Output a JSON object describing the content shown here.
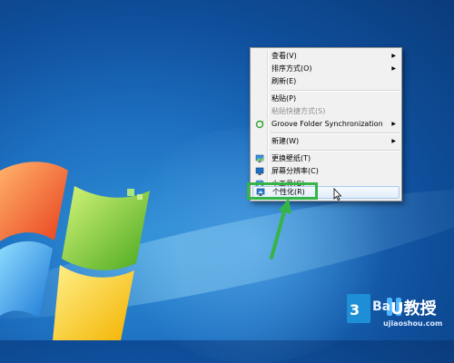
{
  "context_menu": {
    "items": [
      {
        "label": "查看(V)",
        "submenu": true
      },
      {
        "label": "排序方式(O)",
        "submenu": true
      },
      {
        "label": "刷新(E)"
      },
      {
        "label": "粘贴(P)"
      },
      {
        "label": "粘贴快捷方式(S)",
        "disabled": true
      },
      {
        "label": "Groove Folder Synchronization",
        "submenu": true,
        "icon": "groove-sync-icon"
      },
      {
        "label": "新建(W)",
        "submenu": true
      },
      {
        "label": "更换壁纸(T)",
        "icon": "wallpaper-icon"
      },
      {
        "label": "屏幕分辨率(C)",
        "icon": "display-icon"
      },
      {
        "label": "小工具(G)",
        "icon": "gadgets-icon"
      },
      {
        "label": "个性化(R)",
        "icon": "personalize-icon",
        "highlighted": true
      }
    ]
  },
  "colors": {
    "highlight_box": "#35b447",
    "desktop_blue": "#1d6fc0"
  },
  "watermark": {
    "left_text": "Ba",
    "brand_text": "U教授",
    "url_text": "ujiaoshou.com"
  }
}
